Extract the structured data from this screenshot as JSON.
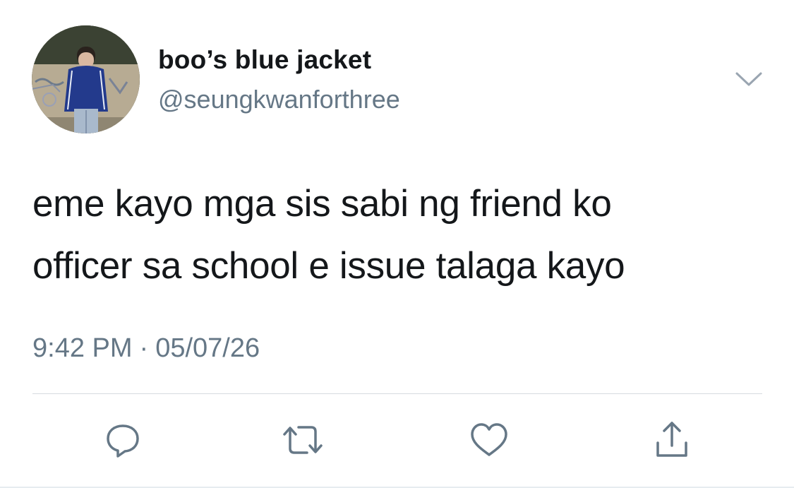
{
  "user": {
    "display_name": "boo’s blue jacket",
    "handle": "@seungkwanforthree"
  },
  "tweet": {
    "text_lines": [
      "eme kayo mga sis sabi ng friend ko",
      "officer sa school e issue talaga kayo"
    ],
    "time": "9:42 PM",
    "separator": "·",
    "date": "05/07/26"
  },
  "actions": [
    {
      "name": "reply",
      "icon": "speech-bubble-icon"
    },
    {
      "name": "retweet",
      "icon": "retweet-arrows-icon"
    },
    {
      "name": "like",
      "icon": "heart-icon"
    },
    {
      "name": "share",
      "icon": "share-upload-icon"
    }
  ],
  "colors": {
    "primary_text": "#14171a",
    "secondary_text": "#657786",
    "icon_gray": "#657786",
    "divider": "#d6dbdf"
  }
}
